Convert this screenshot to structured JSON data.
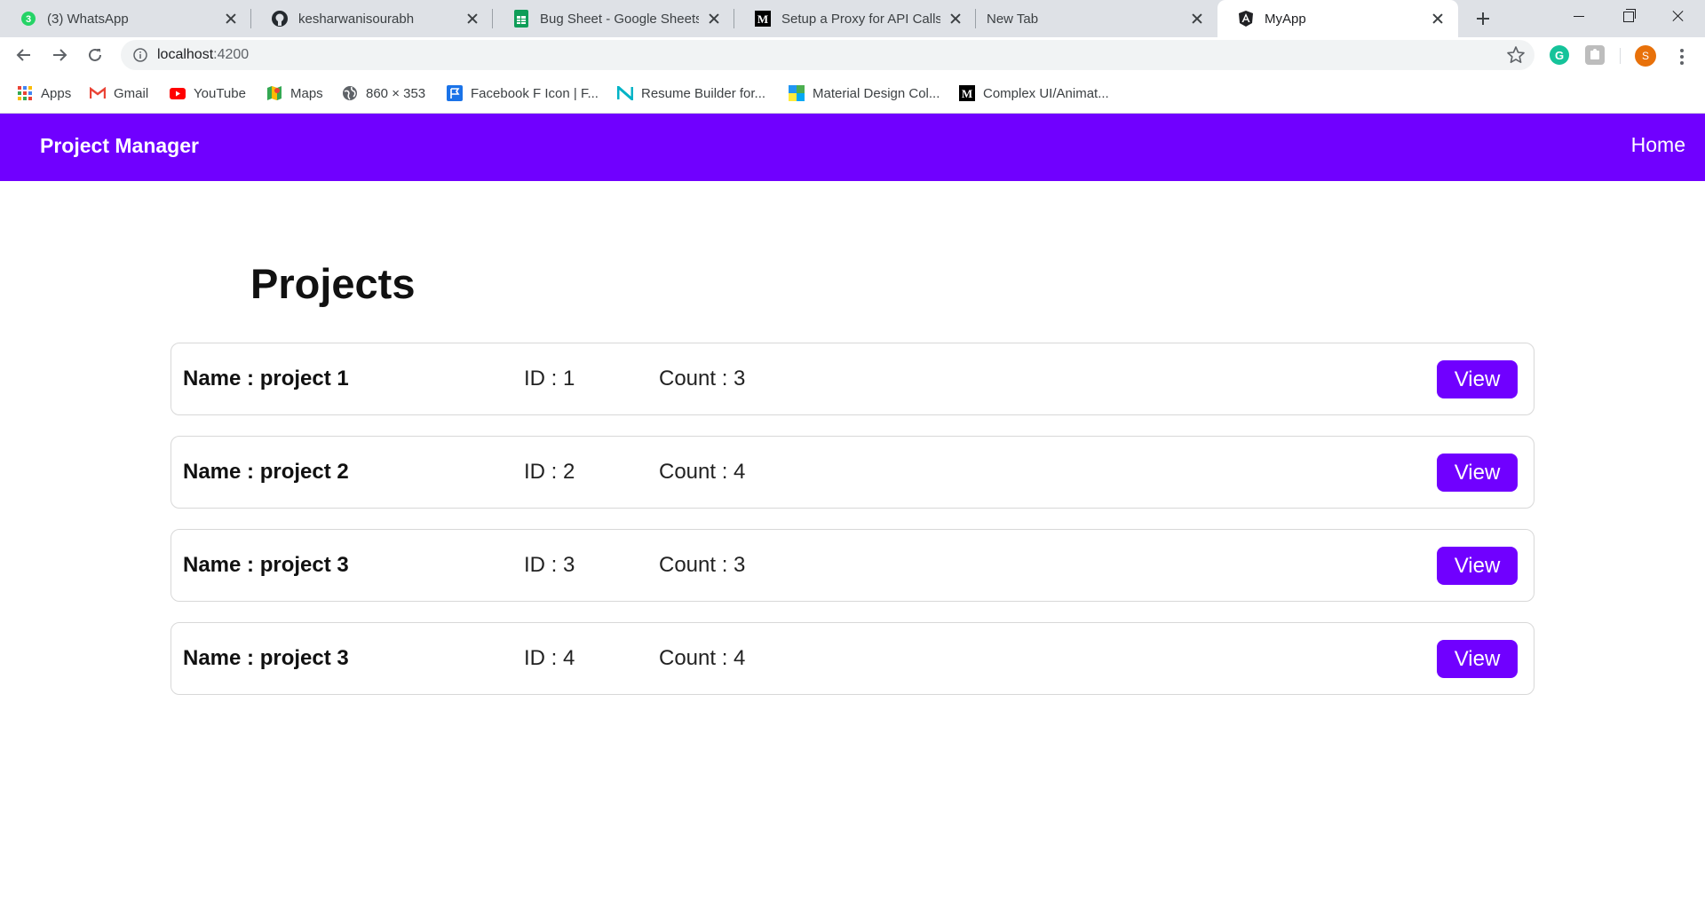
{
  "browser": {
    "tabs": [
      {
        "title": "(3) WhatsApp",
        "icon": "whatsapp-icon",
        "badge": "3",
        "active": false
      },
      {
        "title": "kesharwanisourabh",
        "icon": "github-icon",
        "active": false
      },
      {
        "title": "Bug Sheet - Google Sheets",
        "icon": "google-sheets-icon",
        "active": false
      },
      {
        "title": "Setup a Proxy for API Calls fo",
        "icon": "medium-icon",
        "active": false
      },
      {
        "title": "New Tab",
        "icon": "",
        "active": false
      },
      {
        "title": "MyApp",
        "icon": "angular-icon",
        "active": true
      }
    ],
    "url_host": "localhost",
    "url_port": ":4200",
    "avatar_letter": "S",
    "extensions": [
      "grammarly-icon",
      "extension-icon"
    ],
    "bookmarks": [
      {
        "label": "Apps",
        "icon": "apps-grid-icon"
      },
      {
        "label": "Gmail",
        "icon": "gmail-icon"
      },
      {
        "label": "YouTube",
        "icon": "youtube-icon"
      },
      {
        "label": "Maps",
        "icon": "maps-icon"
      },
      {
        "label": "860 × 353",
        "icon": "globe-icon"
      },
      {
        "label": "Facebook F Icon | F...",
        "icon": "flag-icon"
      },
      {
        "label": "Resume Builder for...",
        "icon": "n-logo-icon"
      },
      {
        "label": "Material Design Col...",
        "icon": "material-palette-icon"
      },
      {
        "label": "Complex UI/Animat...",
        "icon": "medium-icon"
      }
    ],
    "colors": {
      "tabstrip": "#dee1e6",
      "omnibox": "#f1f3f4"
    }
  },
  "app": {
    "brand": "Project Manager",
    "nav_home": "Home",
    "page_title": "Projects",
    "accent_color": "#7000ff",
    "projects": [
      {
        "name": "Name : project 1",
        "id": "ID : 1",
        "count": "Count : 3",
        "action": "View"
      },
      {
        "name": "Name : project 2",
        "id": "ID : 2",
        "count": "Count : 4",
        "action": "View"
      },
      {
        "name": "Name : project 3",
        "id": "ID : 3",
        "count": "Count : 3",
        "action": "View"
      },
      {
        "name": "Name : project 3",
        "id": "ID : 4",
        "count": "Count : 4",
        "action": "View"
      }
    ]
  }
}
